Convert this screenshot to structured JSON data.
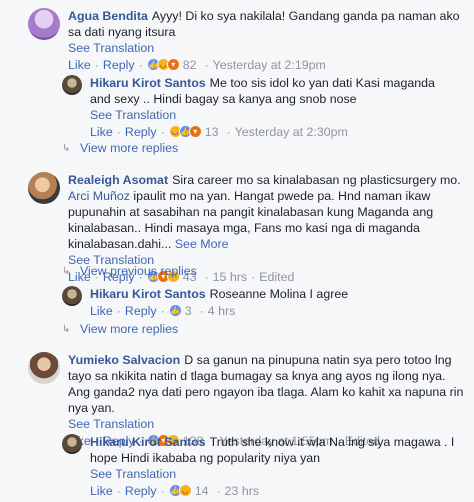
{
  "colors": {
    "link": "#365899",
    "action": "#4267b2",
    "meta": "#90949c",
    "bg": "#f6f7f9"
  },
  "comments": [
    {
      "author": "Agua Bendita",
      "text": "Ayyy! Di ko sya nakilala! Gandang ganda pa naman ako sa dati nyang itsura",
      "see_translation": "See Translation",
      "like": "Like",
      "reply": "Reply",
      "reaction_icons": [
        "like-react-icon",
        "haha-react-icon",
        "angry-react-icon"
      ],
      "reaction_count": "82",
      "time": "Yesterday at 2:19pm"
    },
    {
      "author": "Hikaru Kirot Santos",
      "text": "Me too sis idol ko yan dati Kasi maganda and sexy .. Hindi bagay sa kanya ang snob nose",
      "see_translation": "See Translation",
      "like": "Like",
      "reply": "Reply",
      "reaction_icons": [
        "haha-react-icon",
        "like-react-icon",
        "angry-react-icon"
      ],
      "reaction_count": "13",
      "time": "Yesterday at 2:30pm"
    },
    {
      "author": "Realeigh Asomat",
      "text_before_mention": "Sira career mo sa kinalabasan ng plasticsurgery mo. ",
      "mention": "Arci Muñoz",
      "text_after_mention": " ipaulit mo na yan. Hangat pwede pa. Hnd naman ikaw pupunahin at sasabihan na pangit kinalabasan kung Maganda ang kinalabasan.. Hindi masaya mga, Fans mo kasi nga di maganda kinalabasan.dahi...",
      "see_more": "See More",
      "see_translation": "See Translation",
      "like": "Like",
      "reply": "Reply",
      "reaction_icons": [
        "like-react-icon",
        "angry-react-icon",
        "sad-react-icon"
      ],
      "reaction_count": "43",
      "time": "15 hrs",
      "edited": "Edited"
    },
    {
      "author": "Hikaru Kirot Santos",
      "text": "Roseanne Molina I agree",
      "like": "Like",
      "reply": "Reply",
      "reaction_icons": [
        "like-react-icon"
      ],
      "reaction_count": "3",
      "time": "4 hrs"
    },
    {
      "author": "Yumieko Salvacion",
      "text": "D sa ganun na pinupuna natin sya pero totoo lng tayo sa nkikita natin d tlaga bumagay sa knya ang ayos ng ilong nya. Ang ganda2 nya dati pero ngayon iba tlaga. Alam ko kahit xa napuna rin nya yan.",
      "see_translation": "See Translation",
      "like": "Like",
      "reply": "Reply",
      "reaction_icons": [
        "like-react-icon",
        "angry-react-icon",
        "haha-react-icon"
      ],
      "reaction_count": "138",
      "time": "Yesterday at 1:55pm",
      "edited": "Edited"
    },
    {
      "author": "Hikaru Kirot Santos",
      "text": "Truth she know it wla Na lng siya magawa . I hope Hindi ikababa ng popularity niya yan",
      "see_translation": "See Translation",
      "like": "Like",
      "reply": "Reply",
      "reaction_icons": [
        "like-react-icon",
        "haha-react-icon"
      ],
      "reaction_count": "14",
      "time": "23 hrs"
    }
  ],
  "view_more_replies_1": "View more replies",
  "view_previous_replies": "View previous replies",
  "view_more_replies_2": "View more replies"
}
